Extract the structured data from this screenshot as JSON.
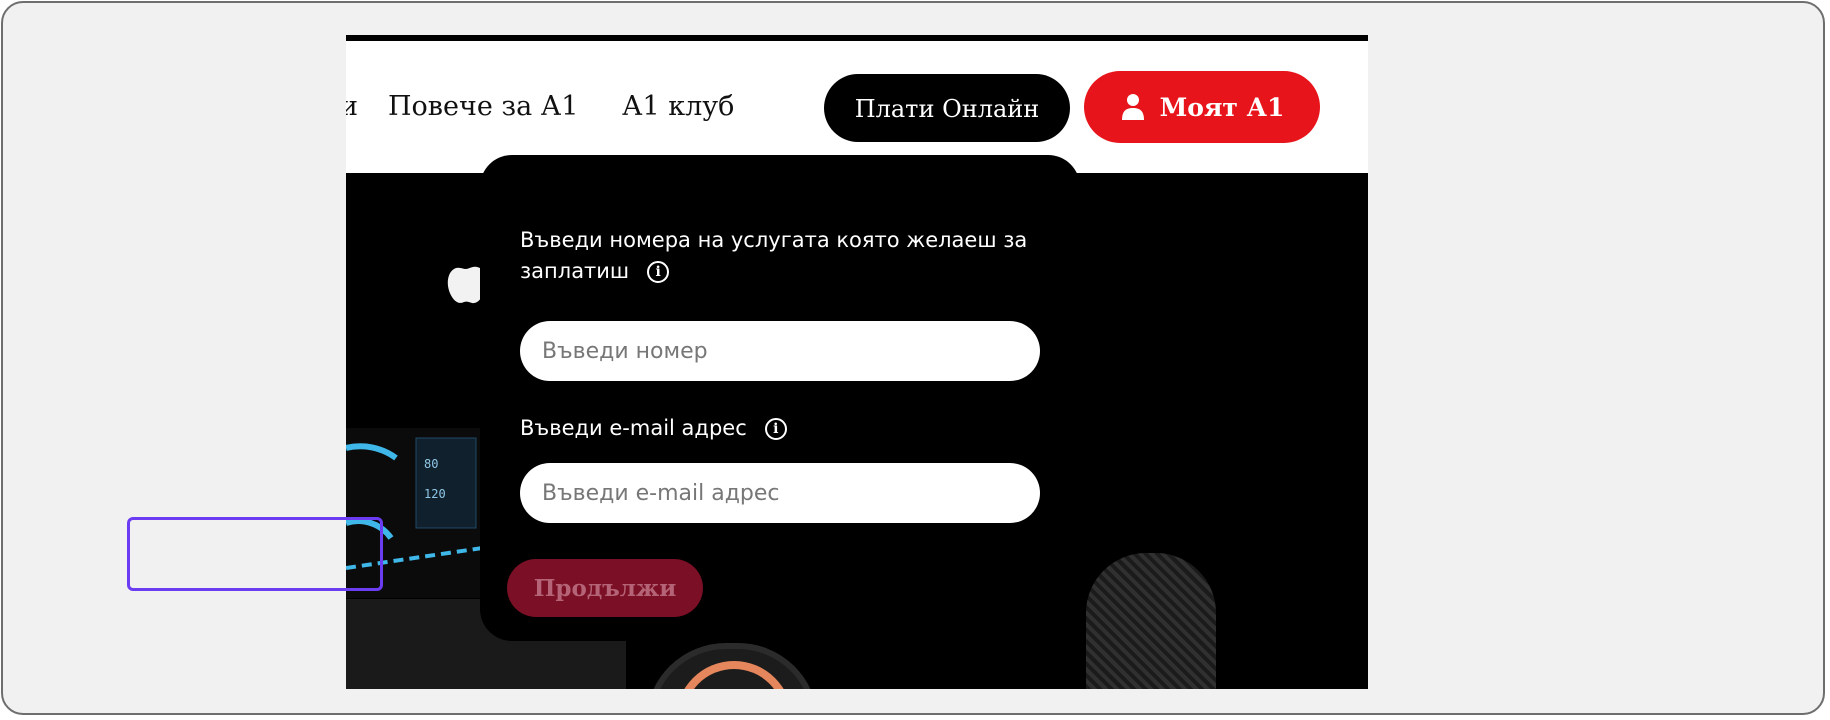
{
  "header": {
    "nav_partial": "и",
    "nav_more": "Повече за А1",
    "nav_club": "А1 клуб",
    "pay_online": "Плати Онлайн",
    "my_a1": "Моят А1"
  },
  "popover": {
    "service_label": "Въведи номера на услугата която желаеш за заплатиш",
    "number_placeholder": "Въведи номер",
    "email_label": "Въведи e-mail адрес",
    "email_placeholder": "Въведи e-mail адрес",
    "continue_label": "Продължи"
  },
  "colors": {
    "brand_red": "#e8141b",
    "disabled_button": "#7a0f25",
    "highlight": "#6b3cf2"
  },
  "icons": [
    "user-icon",
    "info-icon",
    "apple-logo-icon",
    "pointer-cursor-icon"
  ]
}
